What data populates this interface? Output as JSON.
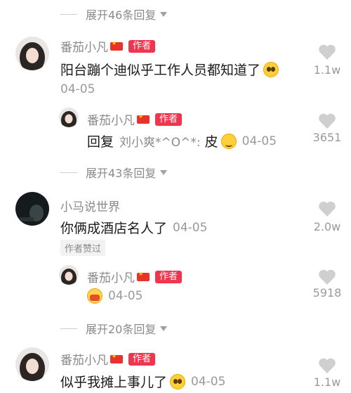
{
  "comments": [
    {
      "expand_label": "展开46条回复"
    },
    {
      "author": "番茄小凡",
      "badge": "作者",
      "text": "阳台蹦个迪似乎工作人员都知道了",
      "emoji": "pleading-face-icon",
      "date": "04-05",
      "likes": "1.1w"
    },
    {
      "author": "番茄小凡",
      "badge": "作者",
      "reply_prefix": "回复",
      "reply_target": "刘小爽*^O^*:",
      "text": "皮",
      "emoji": "smirk-face-icon",
      "date": "04-05",
      "likes": "3651"
    },
    {
      "expand_label": "展开43条回复"
    },
    {
      "author": "小马说世界",
      "text": "你俩成酒店名人了",
      "date": "04-05",
      "liked_by_author": "作者赞过",
      "likes": "2.0w"
    },
    {
      "author": "番茄小凡",
      "badge": "作者",
      "emoji": "mask-face-icon",
      "date": "04-05",
      "likes": "5918"
    },
    {
      "expand_label": "展开20条回复"
    },
    {
      "author": "番茄小凡",
      "badge": "作者",
      "text": "似乎我摊上事儿了",
      "emoji": "pleading-face-icon",
      "date": "04-05",
      "likes": "1.1w"
    }
  ],
  "colors": {
    "badge": "#f0354f",
    "muted": "#8a8a8a",
    "text": "#1a1a1a"
  }
}
